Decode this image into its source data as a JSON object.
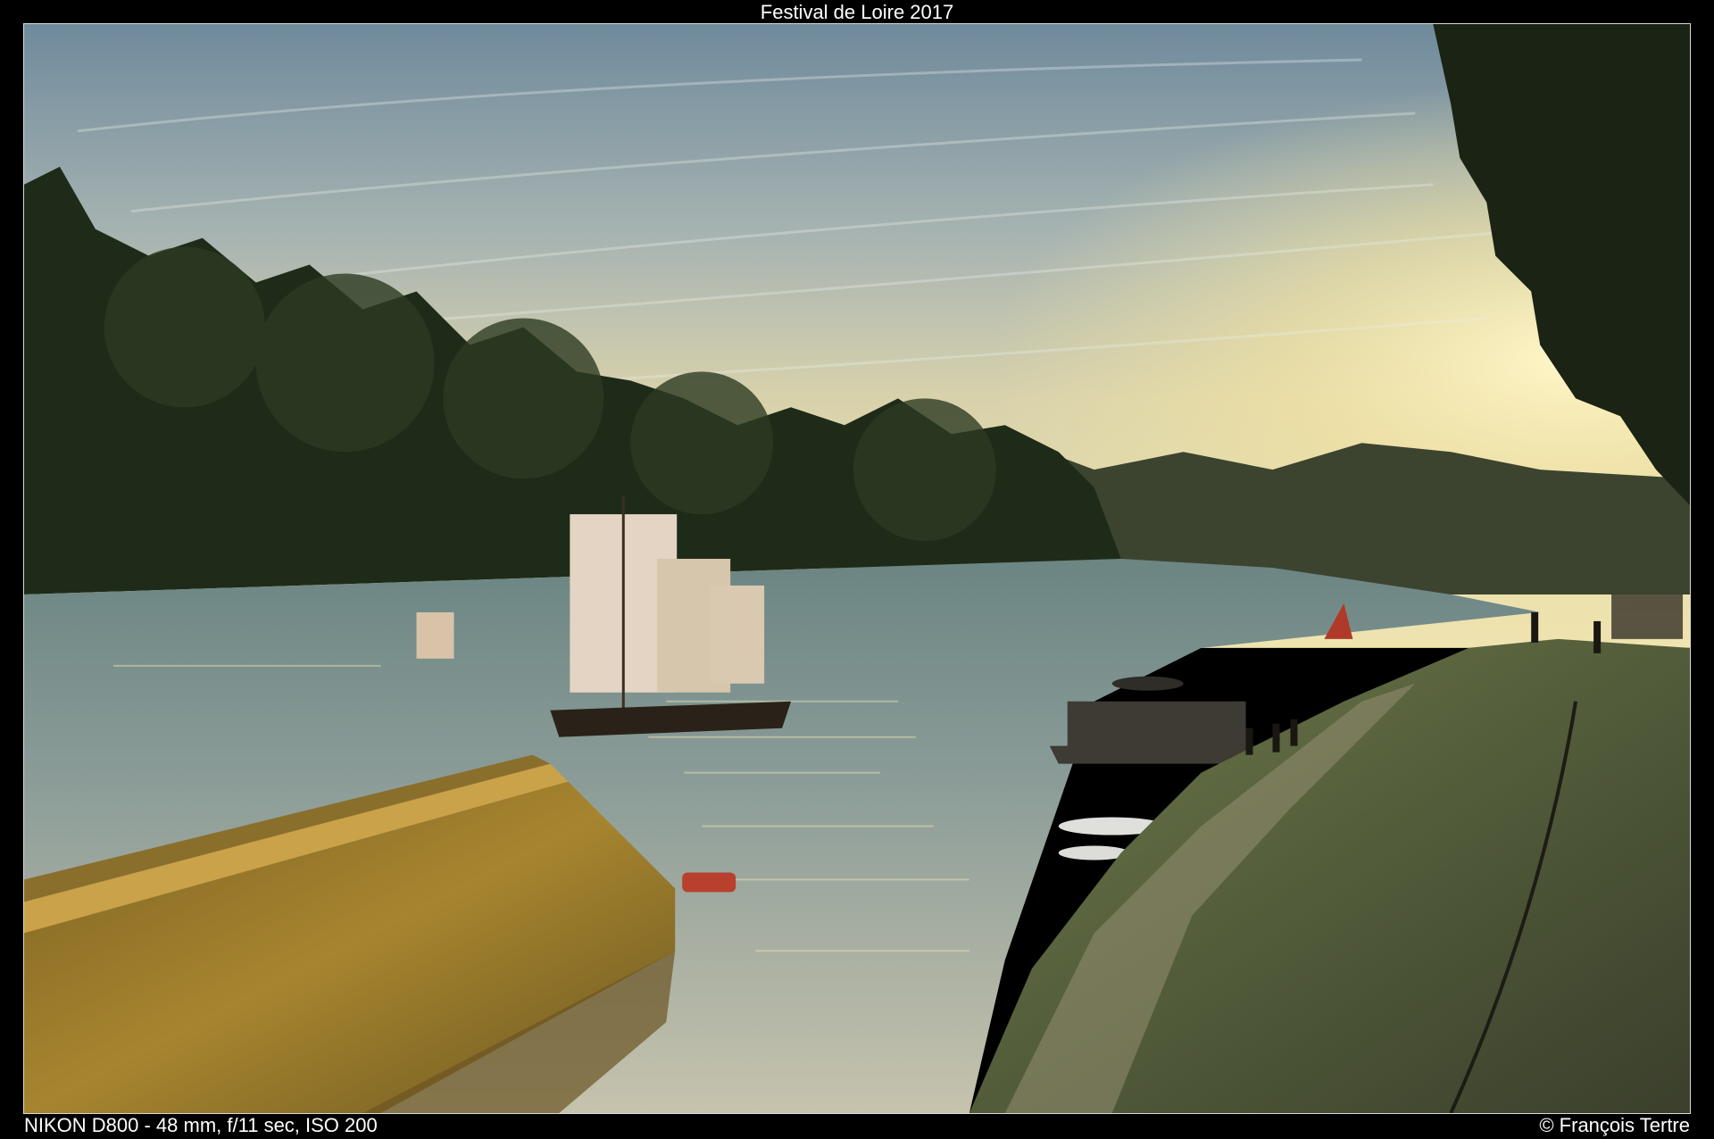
{
  "caption": {
    "title": "Festival de Loire 2017",
    "exif": "NIKON D800 - 48 mm, f/11 sec, ISO 200",
    "credit": "© François Tertre"
  },
  "photo": {
    "scene": "sunset over river with traditional sailing boats",
    "palette": {
      "sky_top": "#7f98a8",
      "sky_mid": "#c9c6ad",
      "sky_glow": "#f4e6a4",
      "water": "#7c8e90",
      "water_glow": "#e9ddb5",
      "trees": "#1e2a18",
      "quay_stone": "#9b7a2c",
      "embankment": "#4a5236",
      "sail": "#e4d6c6"
    }
  }
}
